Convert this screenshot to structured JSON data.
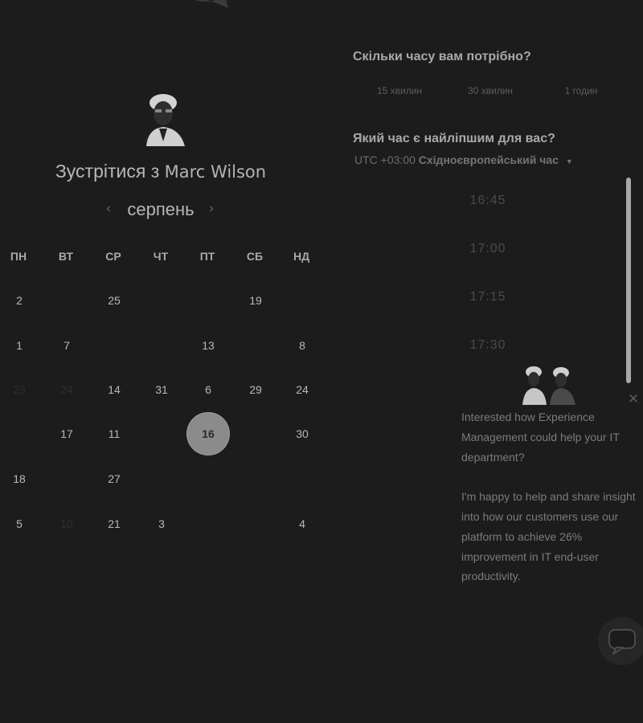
{
  "scheduler": {
    "title_prefix": "Зустрітися з",
    "host_name": "Marc Wilson",
    "month": "серпень",
    "weekdays": [
      "ПН",
      "ВТ",
      "СР",
      "ЧТ",
      "ПТ",
      "СБ",
      "НД"
    ],
    "weeks": [
      [
        {
          "t": "2"
        },
        {
          "t": "",
          "f": true
        },
        {
          "t": "25"
        },
        {
          "t": "",
          "f": true
        },
        {
          "t": "",
          "f": true
        },
        {
          "t": "19"
        },
        {
          "t": "",
          "f": true
        }
      ],
      [
        {
          "t": "1"
        },
        {
          "t": "7"
        },
        {
          "t": ""
        },
        {
          "t": "",
          "f": true
        },
        {
          "t": "13"
        },
        {
          "t": "",
          "f": true
        },
        {
          "t": "8"
        }
      ],
      [
        {
          "t": "23",
          "f": true
        },
        {
          "t": "24",
          "f": true
        },
        {
          "t": "14"
        },
        {
          "t": "31"
        },
        {
          "t": "6"
        },
        {
          "t": "29"
        },
        {
          "t": "24"
        }
      ],
      [
        {
          "t": "",
          "f": true
        },
        {
          "t": "17"
        },
        {
          "t": "11"
        },
        {
          "t": "",
          "f": true
        },
        {
          "t": "16",
          "sel": true
        },
        {
          "t": "",
          "f": true
        },
        {
          "t": "30"
        }
      ],
      [
        {
          "t": "18"
        },
        {
          "t": "",
          "f": true
        },
        {
          "t": "27"
        },
        {
          "t": "",
          "f": true
        },
        {
          "t": ""
        },
        {
          "t": ""
        },
        {
          "t": ""
        }
      ],
      [
        {
          "t": "5"
        },
        {
          "t": "10",
          "f": true
        },
        {
          "t": "21"
        },
        {
          "t": "3"
        },
        {
          "t": "",
          "f": true
        },
        {
          "t": "",
          "f": true
        },
        {
          "t": "4"
        }
      ]
    ]
  },
  "booking": {
    "duration_question": "Скільки часу вам потрібно?",
    "durations": [
      "15 хвилин",
      "30 хвилин",
      "1 годин"
    ],
    "time_question": "Який час є найліпшим для вас?",
    "timezone_offset": "UTC +03:00",
    "timezone_name": "Східноєвропейський час",
    "slots": [
      "16:45",
      "17:00",
      "17:15",
      "17:30"
    ]
  },
  "chat": {
    "message_1": "Interested how Experience Management could help your IT department?",
    "message_2": "I'm happy to help and share insight into how our customers use our platform to achieve 26% improvement in IT end-user productivity."
  },
  "icons": {
    "calendar_prev": "chevron-left-icon",
    "calendar_next": "chevron-right-icon",
    "timezone_caret": "caret-down-icon",
    "close": "close-icon",
    "chat": "chat-bubble-icon"
  },
  "colors": {
    "background": "#1c1c1d",
    "selected_day": "#8b8b8b",
    "scrollbar": "#a8a8a8"
  }
}
